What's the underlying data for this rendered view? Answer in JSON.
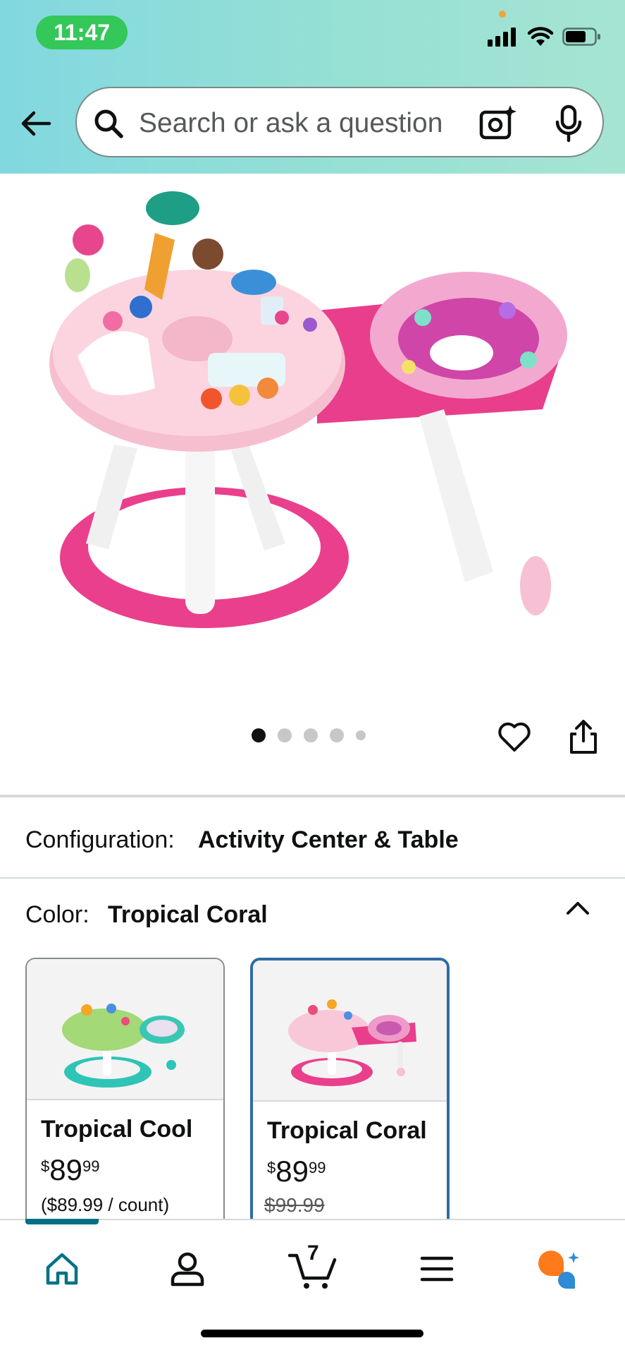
{
  "status_bar": {
    "time": "11:47"
  },
  "search": {
    "placeholder": "Search or ask a question"
  },
  "product_gallery": {
    "image_count": 5,
    "active_index": 0
  },
  "configuration": {
    "label": "Configuration:",
    "value": "Activity Center & Table"
  },
  "color": {
    "label": "Color:",
    "value": "Tropical Coral",
    "swatches": [
      {
        "name": "Tropical Cool",
        "price_symbol": "$",
        "price_whole": "89",
        "price_fraction": "99",
        "unit_price": "($89.99 / count)",
        "selected": false,
        "accent": "#2ec4b6"
      },
      {
        "name": "Tropical Coral",
        "price_symbol": "$",
        "price_whole": "89",
        "price_fraction": "99",
        "list_price": "$99.99",
        "selected": true,
        "accent": "#ea3f8c"
      }
    ]
  },
  "bottom_nav": {
    "items": [
      "home-icon",
      "account-icon",
      "cart-icon",
      "menu-icon",
      "rufus-icon"
    ],
    "cart_count": "7",
    "active": "home-icon"
  },
  "colors": {
    "teal": "#007185",
    "selected_border": "#2e6ca4",
    "pink": "#ea3f8c",
    "rufus_orange": "#ff7a1a",
    "rufus_blue": "#2e8bd6"
  }
}
